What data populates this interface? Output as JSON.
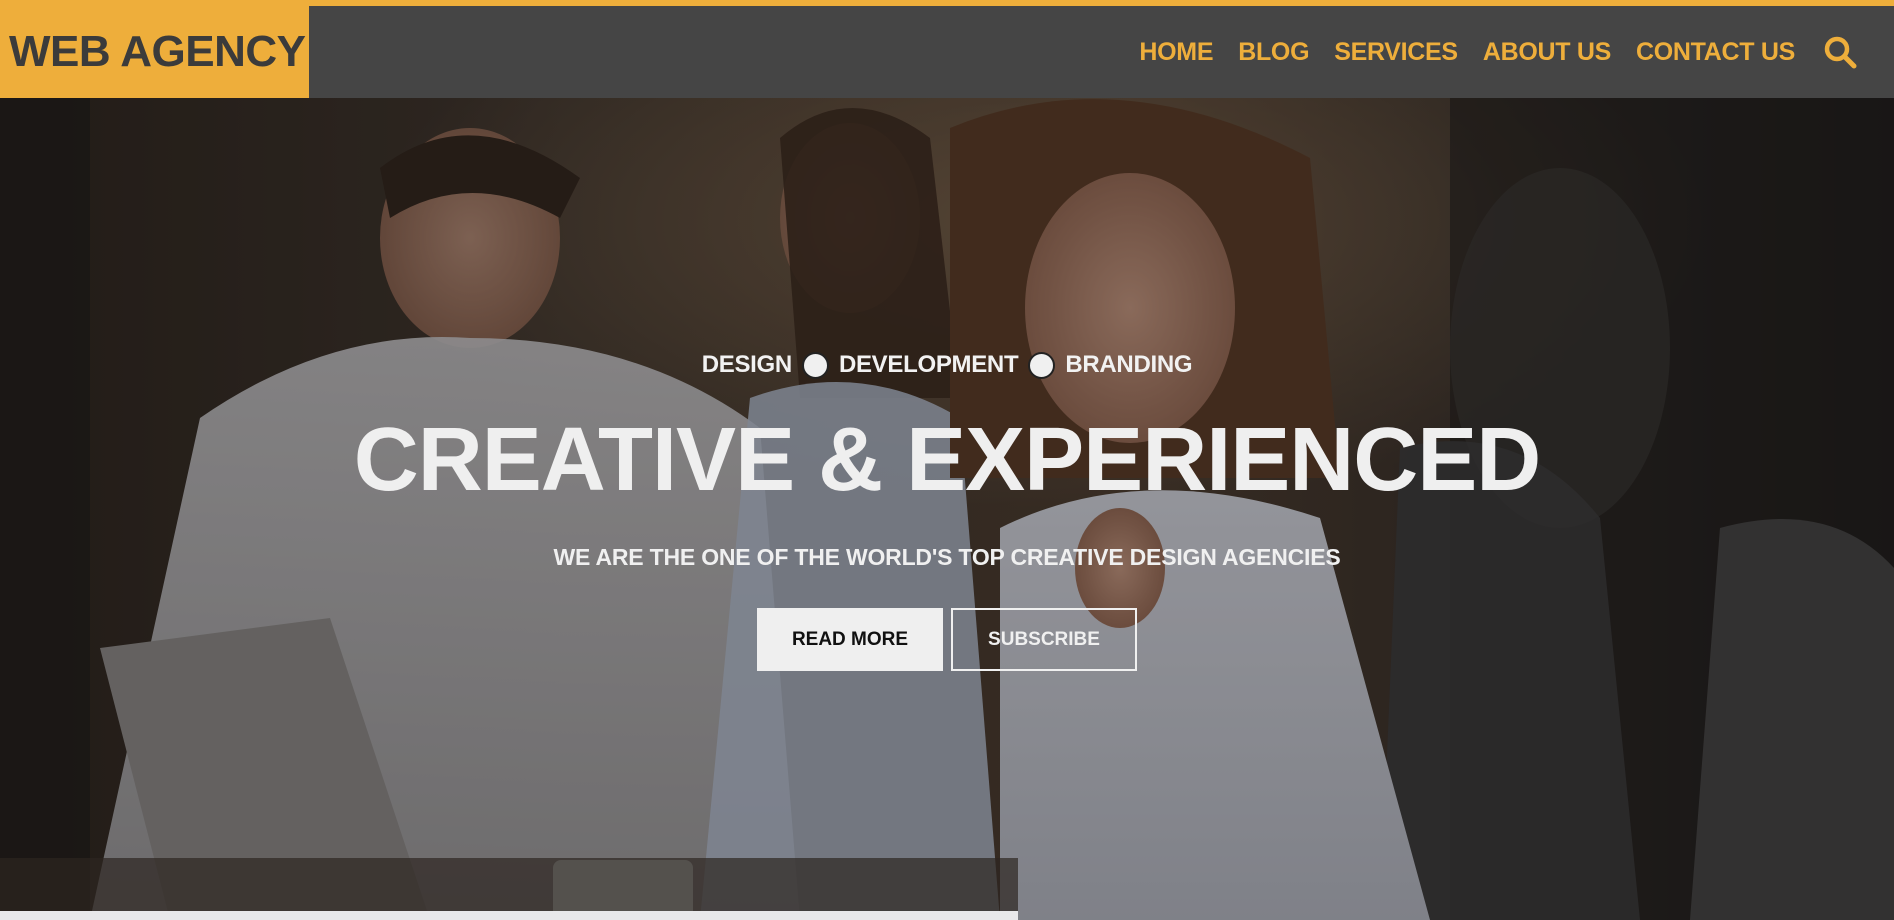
{
  "header": {
    "logo": "WEB AGENCY",
    "nav": [
      "HOME",
      "BLOG",
      "SERVICES",
      "ABOUT US",
      "CONTACT US"
    ],
    "search_icon": "search-icon"
  },
  "hero": {
    "tagline": [
      "DESIGN",
      "DEVELOPMENT",
      "BRANDING"
    ],
    "headline": "CREATIVE & EXPERIENCED",
    "subline": "WE ARE THE ONE OF THE WORLD'S TOP CREATIVE DESIGN AGENCIES",
    "read_more": "READ MORE",
    "subscribe": "SUBSCRIBE"
  },
  "colors": {
    "accent": "#eeae3b",
    "header_bg": "#454545"
  }
}
